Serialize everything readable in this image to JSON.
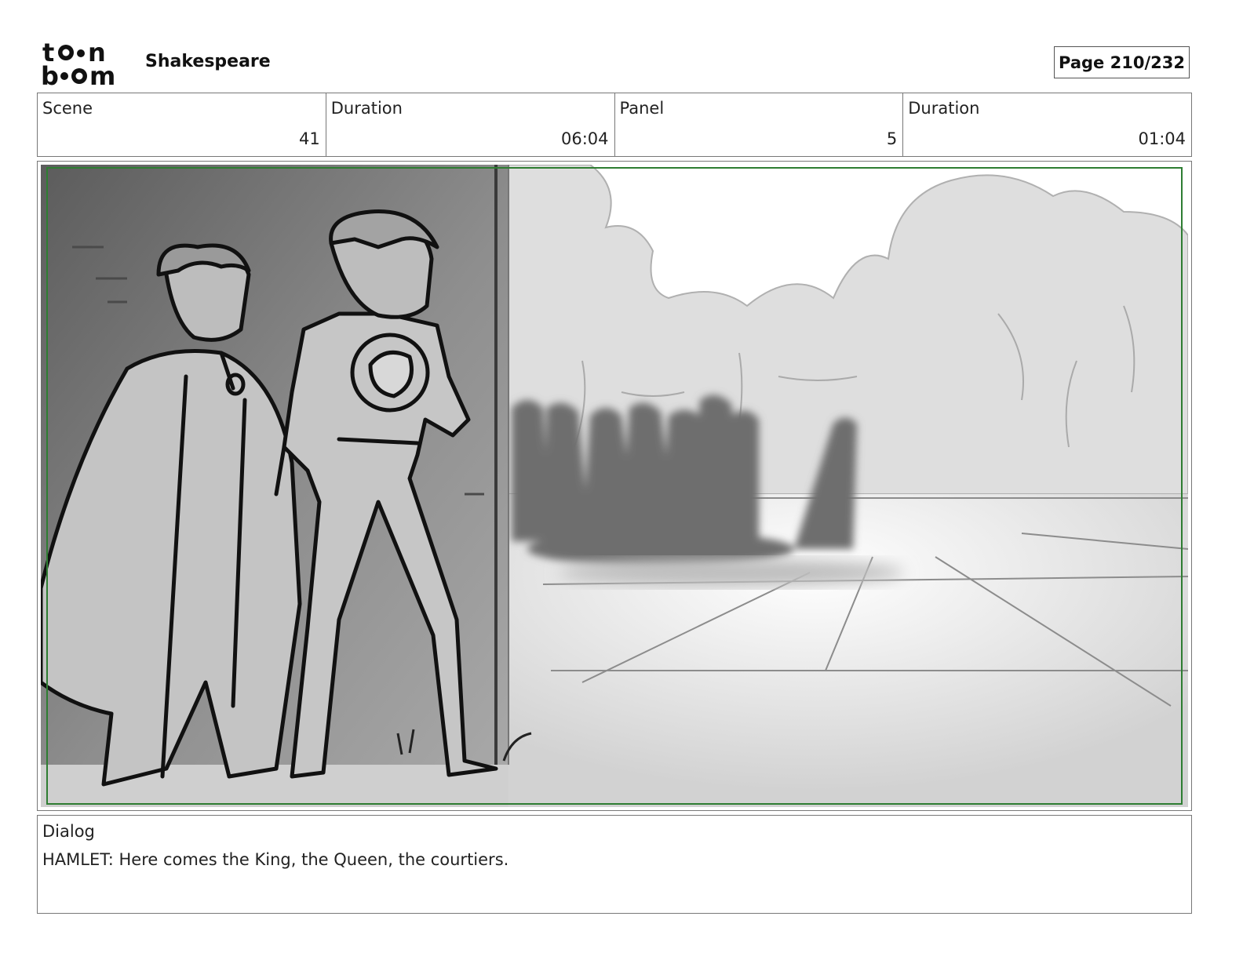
{
  "header": {
    "logo_text": "toonboom",
    "project_title": "Shakespeare",
    "page_label": "Page 210/232"
  },
  "info": {
    "scene_label": "Scene",
    "scene_value": "41",
    "scene_duration_label": "Duration",
    "scene_duration_value": "06:04",
    "panel_label": "Panel",
    "panel_value": "5",
    "panel_duration_label": "Duration",
    "panel_duration_value": "01:04"
  },
  "dialog": {
    "label": "Dialog",
    "text": "HAMLET: Here comes the King, the Queen, the courtiers."
  },
  "colors": {
    "safe_frame": "#2e7d32",
    "border": "#777777"
  }
}
